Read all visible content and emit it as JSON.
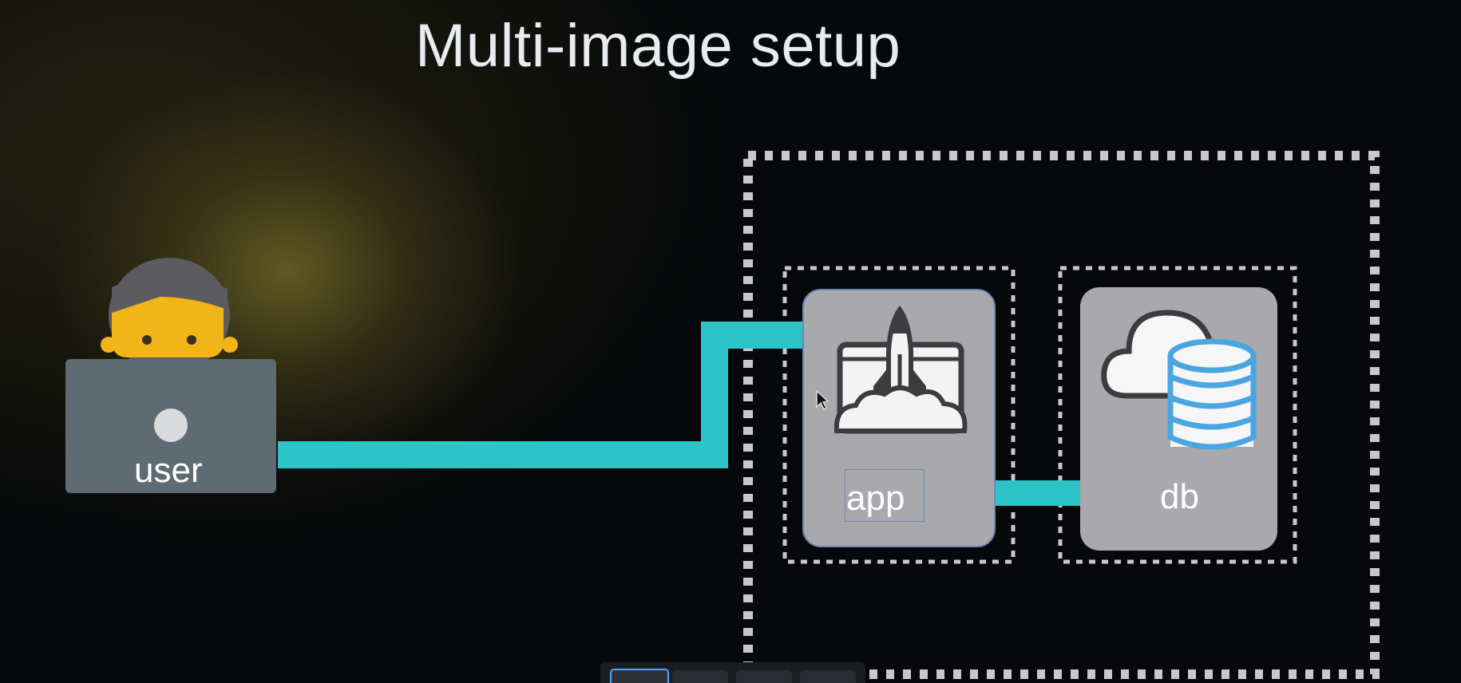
{
  "slide": {
    "title": "Multi-image setup"
  },
  "nodes": {
    "user": {
      "label": "user",
      "icon": "user-laptop-icon"
    },
    "app": {
      "label": "app",
      "icon": "rocket-launch-icon"
    },
    "db": {
      "label": "db",
      "icon": "cloud-database-icon"
    }
  },
  "colors": {
    "connector": "#2cc4c9",
    "node_fill": "#a9a8ad",
    "laptop_fill": "#5f6b73",
    "dotted_border": "#c8c8cc",
    "db_accent": "#4aa6e0"
  }
}
